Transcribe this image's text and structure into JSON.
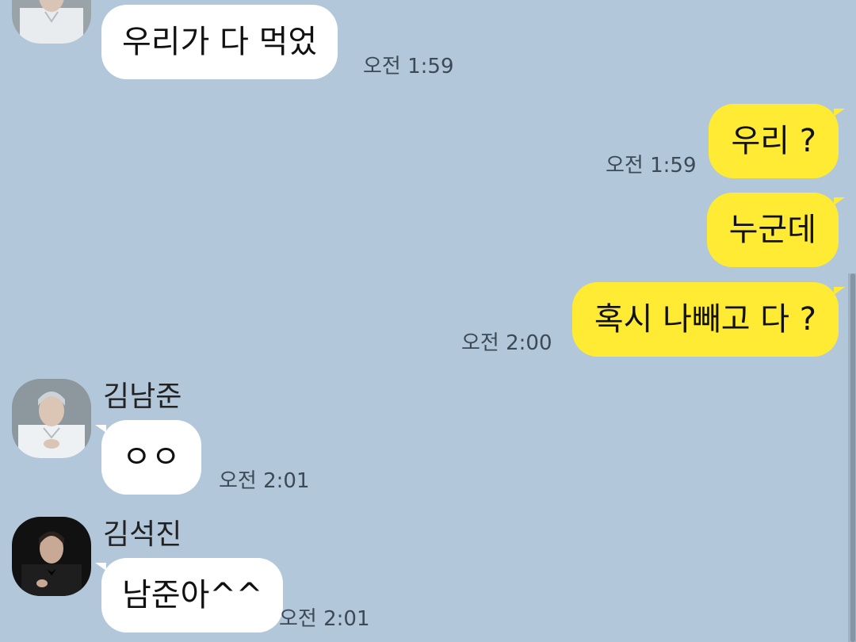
{
  "messages": [
    {
      "sender": "",
      "text": "우리가 다 먹었",
      "time": "오전 1:59",
      "direction": "in"
    },
    {
      "text": "우리 ?",
      "time": "오전 1:59",
      "direction": "out"
    },
    {
      "text": "누군데",
      "time": "",
      "direction": "out"
    },
    {
      "text": "혹시 나빼고 다 ?",
      "time": "오전 2:00",
      "direction": "out"
    },
    {
      "sender": "김남준",
      "text": "ㅇㅇ",
      "time": "오전 2:01",
      "direction": "in"
    },
    {
      "sender": "김석진",
      "text": "남준아^^",
      "time": "오전 2:01",
      "direction": "in"
    }
  ],
  "colors": {
    "background": "#b2c7d9",
    "incoming_bubble": "#ffffff",
    "outgoing_bubble": "#ffeb33"
  }
}
